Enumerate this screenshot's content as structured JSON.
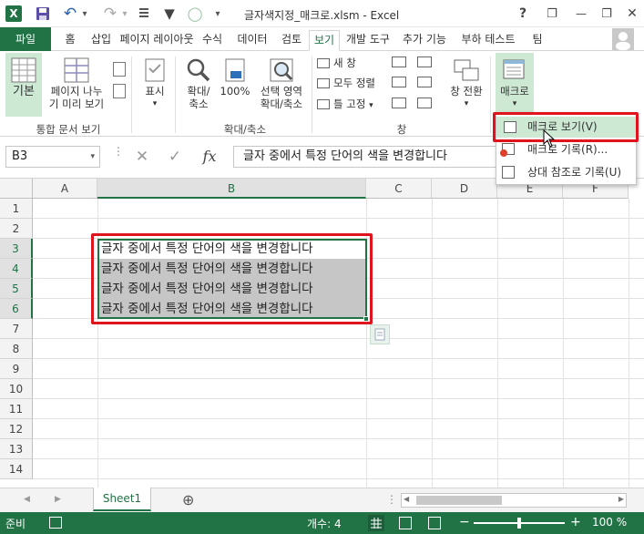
{
  "window": {
    "title": "글자색지정_매크로.xlsm - Excel",
    "help": "?",
    "minimize": "—",
    "restore": "❐",
    "close": "✕"
  },
  "quick_access": {
    "excel_logo": "X",
    "save_label": "💾",
    "undo_label": "↶",
    "redo_label": "↷",
    "dropdown": "▾",
    "filter": "▼",
    "circle": "◯",
    "more": "▾"
  },
  "ribbon_tabs": {
    "file": "파일",
    "items": [
      "홈",
      "삽입",
      "페이지 레이아웃",
      "수식",
      "데이터",
      "검토",
      "보기",
      "개발 도구",
      "추가 기능",
      "부하 테스트",
      "팀"
    ]
  },
  "ribbon": {
    "workbook_views": {
      "normal": "기본",
      "page_break_1": "페이지 나누",
      "page_break_2": "기 미리 보기",
      "label": "통합 문서 보기"
    },
    "show": {
      "label": "표시"
    },
    "zoom": {
      "zoom_1": "확대/",
      "zoom_2": "축소",
      "zoom100": "100%",
      "zoom_sel_1": "선택 영역",
      "zoom_sel_2": "확대/축소",
      "label": "확대/축소"
    },
    "window": {
      "new_window": "새 창",
      "arrange_all": "모두 정렬",
      "freeze": "틀 고정",
      "switch": "창 전환",
      "label": "창"
    },
    "macros": {
      "label": "매크로"
    }
  },
  "macro_menu": {
    "items": [
      "매크로 보기(V)",
      "매크로 기록(R)...",
      "상대 참조로 기록(U)"
    ]
  },
  "formula_bar": {
    "name_box": "B3",
    "cancel": "✕",
    "enter": "✓",
    "fx": "fx",
    "content": "글자 중에서 특정 단어의 색을 변경합니다"
  },
  "grid": {
    "columns": [
      "A",
      "B",
      "C",
      "D",
      "E",
      "F"
    ],
    "rows": [
      "1",
      "2",
      "3",
      "4",
      "5",
      "6",
      "7",
      "8",
      "9",
      "10",
      "11",
      "12",
      "13",
      "14"
    ],
    "cells": {
      "B3": "글자 중에서 특정 단어의 색을 변경합니다",
      "B4": "글자 중에서 특정 단어의 색을 변경합니다",
      "B5": "글자 중에서 특정 단어의 색을 변경합니다",
      "B6": "글자 중에서 특정 단어의 색을 변경합니다"
    }
  },
  "sheets": {
    "tabs": [
      "Sheet1"
    ],
    "add": "⊕",
    "nav_prev": "◀",
    "nav_next": "▶"
  },
  "status_bar": {
    "mode": "준비",
    "count": "개수: 4",
    "zoom_minus": "−",
    "zoom_plus": "+",
    "zoom": "100 %"
  },
  "colors": {
    "accent": "#217346",
    "highlight_red": "#e0141e",
    "selection_gray": "#bfbfbf"
  }
}
